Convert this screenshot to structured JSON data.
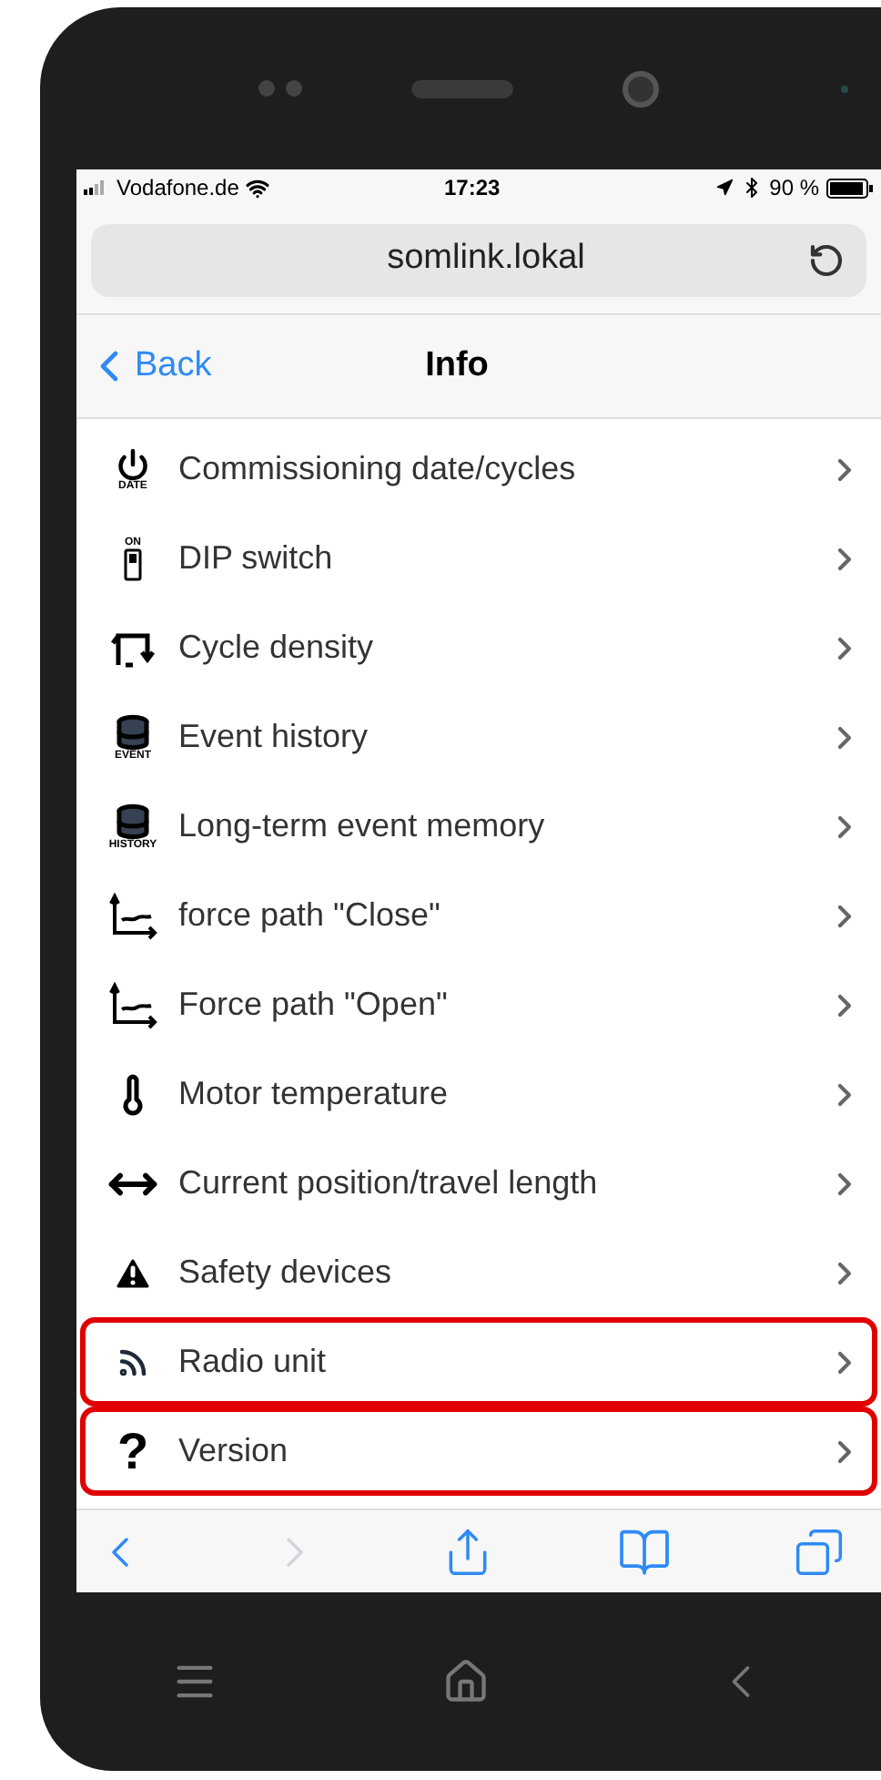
{
  "status_bar": {
    "carrier": "Vodafone.de",
    "time": "17:23",
    "battery": "90 %"
  },
  "address_bar": {
    "url": "somlink.lokal"
  },
  "nav_bar": {
    "back": "Back",
    "title": "Info"
  },
  "items": [
    {
      "kind": "power",
      "icon_text": "DATE",
      "label": "Commissioning date/cycles",
      "highlighted": false
    },
    {
      "kind": "dip",
      "icon_text": "ON",
      "label": "DIP switch",
      "highlighted": false
    },
    {
      "kind": "cycle",
      "label": "Cycle density",
      "highlighted": false
    },
    {
      "kind": "database",
      "icon_text": "EVENT",
      "label": "Event history",
      "highlighted": false
    },
    {
      "kind": "database",
      "icon_text": "HISTORY",
      "label": "Long-term event memory",
      "highlighted": false
    },
    {
      "kind": "chart",
      "label": "force path \"Close\"",
      "highlighted": false
    },
    {
      "kind": "chart",
      "label": "Force path \"Open\"",
      "highlighted": false
    },
    {
      "kind": "thermometer",
      "label": "Motor temperature",
      "highlighted": false
    },
    {
      "kind": "arrows",
      "label": "Current position/travel length",
      "highlighted": false
    },
    {
      "kind": "warning",
      "label": "Safety devices",
      "highlighted": false
    },
    {
      "kind": "radio",
      "label": "Radio unit",
      "highlighted": true
    },
    {
      "kind": "question",
      "icon_text": "?",
      "label": "Version",
      "highlighted": true
    }
  ],
  "toolbar": [
    {
      "kind": "back",
      "disabled": false
    },
    {
      "kind": "forward",
      "disabled": true
    },
    {
      "kind": "share",
      "disabled": false
    },
    {
      "kind": "bookmarks",
      "disabled": false
    },
    {
      "kind": "tabs",
      "disabled": false
    }
  ]
}
